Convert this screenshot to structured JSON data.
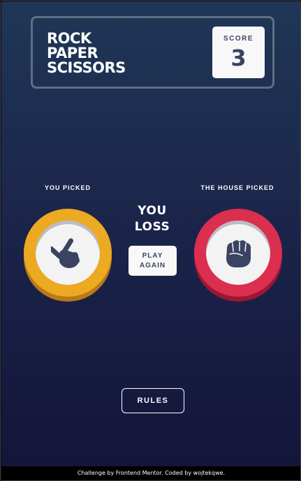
{
  "header": {
    "title_lines": [
      "ROCK",
      "PAPER",
      "SCISSORS"
    ],
    "score_label": "SCORE",
    "score_value": "3"
  },
  "game": {
    "you_picked_label": "YOU PICKED",
    "house_picked_label": "THE HOUSE PICKED",
    "you_pick": {
      "choice": "scissors",
      "icon": "scissors-hand-icon",
      "ring_color": "#eca922"
    },
    "house_pick": {
      "choice": "rock",
      "icon": "rock-fist-icon",
      "ring_color": "#dc2e4e"
    },
    "result_lines": [
      "YOU",
      "LOSS"
    ],
    "play_again_lines": [
      "PLAY",
      "AGAIN"
    ]
  },
  "rules_label": "RULES",
  "footer": {
    "text": "Challenge by Frontend Mentor. Coded by wojtekqwe."
  },
  "colors": {
    "background_top": "#1f3756",
    "background_bottom": "#141539",
    "dark_text": "#3b4363",
    "header_outline": "#606e85"
  }
}
